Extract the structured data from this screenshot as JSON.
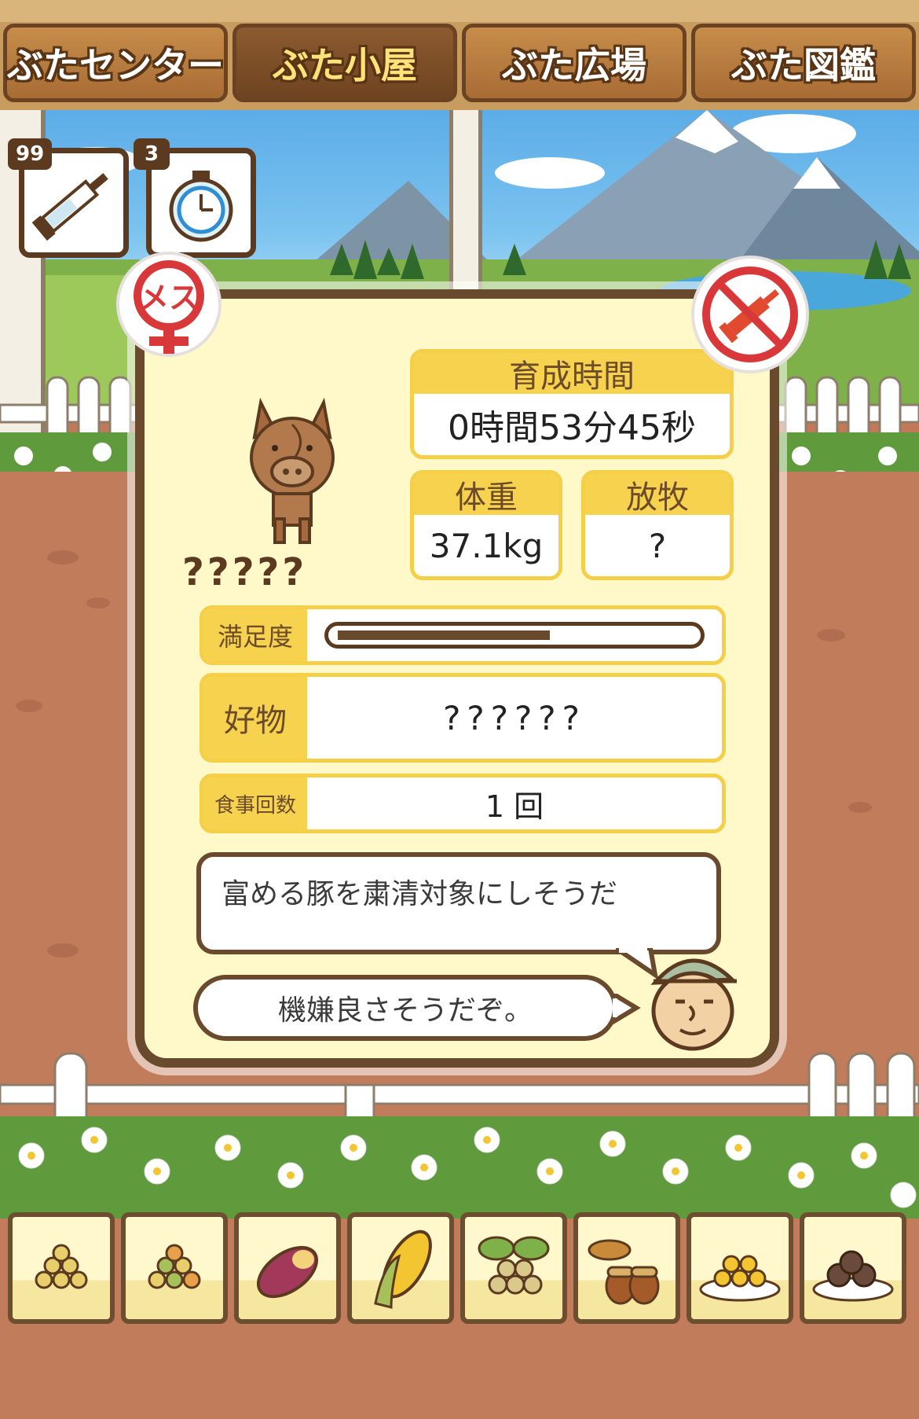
{
  "nav": {
    "tabs": [
      {
        "label": "ぶたセンター"
      },
      {
        "label": "ぶた小屋"
      },
      {
        "label": "ぶた広場"
      },
      {
        "label": "ぶた図鑑"
      }
    ],
    "active_tab": "ぶた小屋"
  },
  "items": {
    "syringe_count": "99",
    "timer_count": "3"
  },
  "pig": {
    "gender_label": "メス",
    "name": "?????",
    "growth_time_label": "育成時間",
    "growth_time_value": "0時間53分45秒",
    "weight_label": "体重",
    "weight_value": "37.1kg",
    "grazing_label": "放牧",
    "grazing_value": "?",
    "satisfaction_label": "満足度",
    "satisfaction_fraction": 0.6,
    "favorite_label": "好物",
    "favorite_value": "??????",
    "meals_label": "食事回数",
    "meals_value": "1 回"
  },
  "dialogue": {
    "speech_main": "富める豚を粛清対象にしそうだ",
    "speech_farmer": "機嫌良さそうだぞ。"
  },
  "food_items": [
    "grain-pile-icon",
    "mixed-grain-icon",
    "sweet-potato-icon",
    "corn-icon",
    "soybean-plant-icon",
    "acorn-icon",
    "grain-plate-icon",
    "meatball-plate-icon"
  ],
  "colors": {
    "accent_yellow": "#f7d24e",
    "card_border": "#6a4a2c",
    "female_red": "#d9383a",
    "ground": "#c17c5b"
  }
}
